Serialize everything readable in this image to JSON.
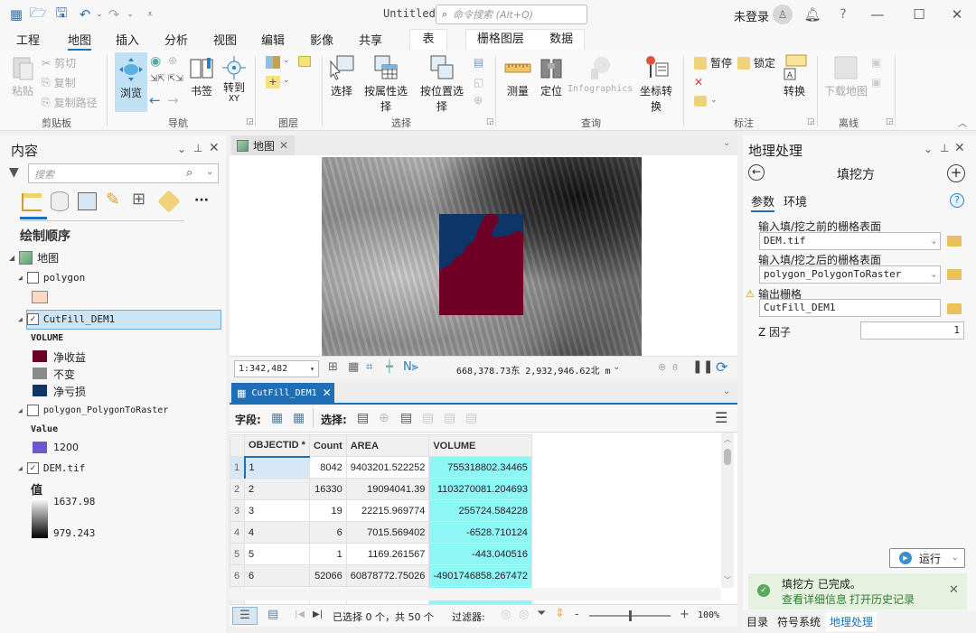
{
  "titlebar": {
    "document_title": "Untitled",
    "search_placeholder": "命令搜索 (Alt+Q)",
    "signin_status": "未登录",
    "quick_access": [
      "new-project-icon",
      "open-project-icon",
      "save-project-icon",
      "undo-icon",
      "redo-icon",
      "customize-icon"
    ],
    "window_controls": {
      "minimize": "—",
      "maximize": "☐",
      "close": "✕"
    }
  },
  "menu_tabs": [
    {
      "label": "工程"
    },
    {
      "label": "地图",
      "active": true
    },
    {
      "label": "插入"
    },
    {
      "label": "分析"
    },
    {
      "label": "视图"
    },
    {
      "label": "编辑"
    },
    {
      "label": "影像"
    },
    {
      "label": "共享"
    }
  ],
  "context_tabs": [
    {
      "label": "表"
    },
    {
      "label": "栅格图层"
    },
    {
      "label": "数据"
    }
  ],
  "ribbon": {
    "clipboard": {
      "label": "剪贴板",
      "paste": "粘贴",
      "cut": "剪切",
      "copy": "复制",
      "copy_path": "复制路径"
    },
    "navigate": {
      "label": "导航",
      "explore": "浏览",
      "bookmarks": "书签",
      "goto_xy": "转到",
      "goto_xy_sub": "XY"
    },
    "layer": {
      "label": "图层"
    },
    "selection": {
      "label": "选择",
      "select": "选择",
      "select_by_attr": "按属性选择",
      "select_by_loc": "按位置选择"
    },
    "inquiry": {
      "label": "查询",
      "measure": "测量",
      "locate": "定位",
      "infographics": "Infographics",
      "coord_convert": "坐标转换"
    },
    "labeling": {
      "label": "标注",
      "pause": "暂停",
      "lock": "锁定",
      "convert": "转换"
    },
    "offline": {
      "label": "离线",
      "download_map": "下载地图"
    }
  },
  "contents": {
    "title": "内容",
    "search_placeholder": "搜索",
    "drawing_order": "绘制顺序",
    "map_name": "地图",
    "layers": [
      {
        "name": "polygon",
        "checked": false,
        "legend": [
          {
            "color": "#fcd9c4",
            "label": ""
          }
        ]
      },
      {
        "name": "CutFill_DEM1",
        "checked": true,
        "selected": true,
        "field": "VOLUME",
        "legend": [
          {
            "color": "#6f0025",
            "label": "净收益"
          },
          {
            "color": "#8a8a8a",
            "label": "不变"
          },
          {
            "color": "#0e3567",
            "label": "净亏损"
          }
        ]
      },
      {
        "name": "polygon_PolygonToRaster",
        "checked": false,
        "field": "Value",
        "legend": [
          {
            "color": "#6a5acd",
            "label": "1200"
          }
        ]
      },
      {
        "name": "DEM.tif",
        "checked": true,
        "field": "值",
        "ramp_high": "1637.98",
        "ramp_low": "979.243"
      }
    ]
  },
  "map_view": {
    "tab_label": "地图",
    "scale": "1:342,482",
    "coordinates": "668,378.73东 2,932,946.62北 m",
    "selected_count": "0"
  },
  "attribute_table": {
    "tab_label": "CutFill_DEM1",
    "fields_label": "字段:",
    "selection_label": "选择:",
    "columns": [
      "OBJECTID *",
      "Count",
      "AREA",
      "VOLUME"
    ],
    "rows": [
      {
        "row": "1",
        "objectid": "1",
        "count": "8042",
        "area": "9403201.522252",
        "volume": "755318802.34465"
      },
      {
        "row": "2",
        "objectid": "2",
        "count": "16330",
        "area": "19094041.39",
        "volume": "1103270081.204693"
      },
      {
        "row": "3",
        "objectid": "3",
        "count": "19",
        "area": "22215.969774",
        "volume": "255724.584228"
      },
      {
        "row": "4",
        "objectid": "4",
        "count": "6",
        "area": "7015.569402",
        "volume": "-6528.710124"
      },
      {
        "row": "5",
        "objectid": "5",
        "count": "1",
        "area": "1169.261567",
        "volume": "-443.040516"
      },
      {
        "row": "6",
        "objectid": "6",
        "count": "52066",
        "area": "60878772.75026",
        "volume": "-4901746858.267472"
      }
    ],
    "status": "已选择 0 个，共 50 个",
    "filter_label": "过滤器:",
    "zoom_level": "100%",
    "zoom_fraction": 0.5
  },
  "geoprocessing": {
    "title": "地理处理",
    "tool_name": "填挖方",
    "tabs": [
      {
        "label": "参数",
        "active": true
      },
      {
        "label": "环境"
      }
    ],
    "params": {
      "before_label": "输入填/挖之前的栅格表面",
      "before_value": "DEM.tif",
      "after_label": "输入填/挖之后的栅格表面",
      "after_value": "polygon_PolygonToRaster",
      "output_label": "输出栅格",
      "output_value": "CutFill_DEM1",
      "zfactor_label": "Z 因子",
      "zfactor_value": "1"
    },
    "run_label": "运行",
    "completion_message": "填挖方 已完成。",
    "view_details": "查看详细信息",
    "open_history": "打开历史记录",
    "bottom_tabs": [
      {
        "label": "目录"
      },
      {
        "label": "符号系统"
      },
      {
        "label": "地理处理",
        "active": true
      }
    ]
  },
  "colors": {
    "accent": "#1e6fb6",
    "net_gain": "#6f0025",
    "net_loss": "#0e3567",
    "volume_highlight": "#8ff6f6",
    "success": "#4caf50"
  }
}
